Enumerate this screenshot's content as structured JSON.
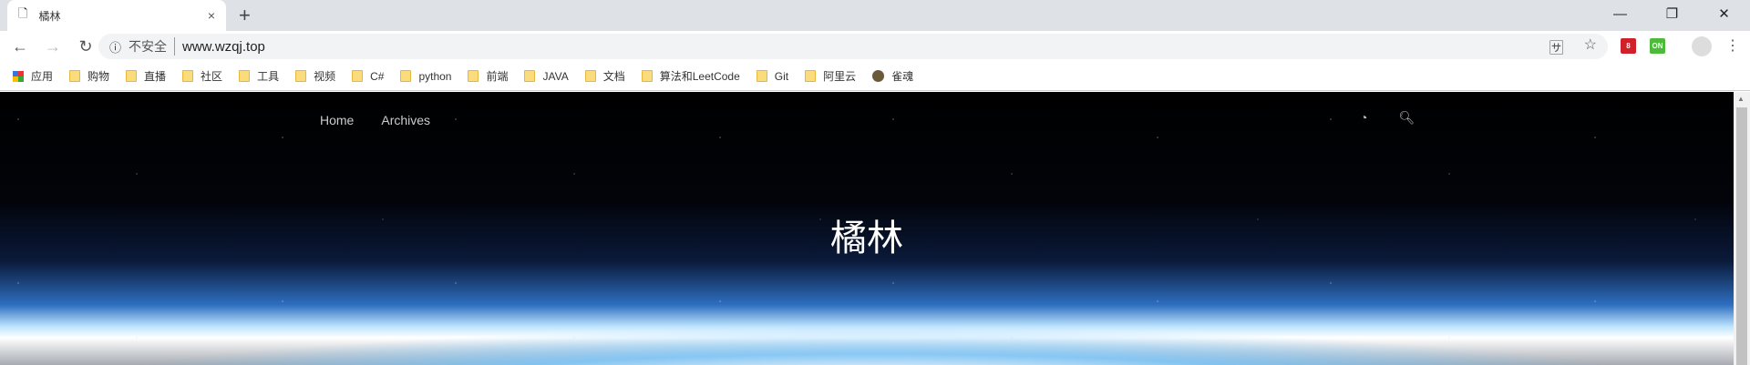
{
  "tab": {
    "title": "橘林",
    "close": "×",
    "new_tab": "+"
  },
  "window": {
    "minimize": "—",
    "restore": "❐",
    "close": "✕"
  },
  "address": {
    "security": "不安全",
    "url": "www.wzqj.top"
  },
  "bookmarks": [
    {
      "label": "应用",
      "icon": "apps-grid-icon"
    },
    {
      "label": "购物"
    },
    {
      "label": "直播"
    },
    {
      "label": "社区"
    },
    {
      "label": "工具"
    },
    {
      "label": "视频"
    },
    {
      "label": "C#"
    },
    {
      "label": "python"
    },
    {
      "label": "前端"
    },
    {
      "label": "JAVA"
    },
    {
      "label": "文档"
    },
    {
      "label": "算法和LeetCode"
    },
    {
      "label": "Git"
    },
    {
      "label": "阿里云"
    },
    {
      "label": "雀魂",
      "icon": "site-favicon"
    }
  ],
  "site": {
    "nav": [
      "Home",
      "Archives"
    ],
    "title": "橘林"
  },
  "colors": {
    "ext_red": "#d0202a",
    "ext_green": "#4cbb3a"
  }
}
